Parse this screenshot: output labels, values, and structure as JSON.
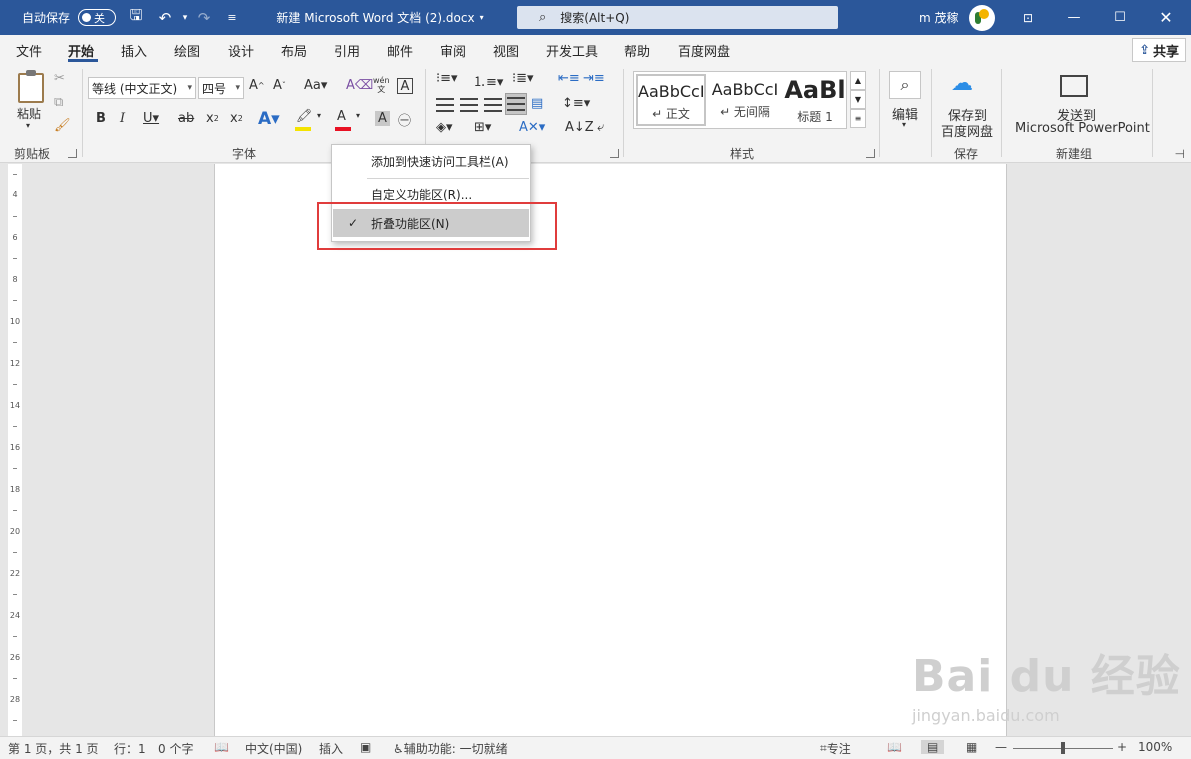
{
  "titlebar": {
    "autosave_label": "自动保存",
    "autosave_state": "关",
    "doc_title": "新建 Microsoft Word 文档 (2).docx",
    "search_placeholder": "搜索(Alt+Q)",
    "user_name": "m 茂稼"
  },
  "tabs": [
    {
      "label": "文件",
      "active": false
    },
    {
      "label": "开始",
      "active": true
    },
    {
      "label": "插入",
      "active": false
    },
    {
      "label": "绘图",
      "active": false
    },
    {
      "label": "设计",
      "active": false
    },
    {
      "label": "布局",
      "active": false
    },
    {
      "label": "引用",
      "active": false
    },
    {
      "label": "邮件",
      "active": false
    },
    {
      "label": "审阅",
      "active": false
    },
    {
      "label": "视图",
      "active": false
    },
    {
      "label": "开发工具",
      "active": false
    },
    {
      "label": "帮助",
      "active": false
    },
    {
      "label": "百度网盘",
      "active": false
    }
  ],
  "share_label": "共享",
  "ribbon": {
    "clipboard": {
      "paste_label": "粘贴",
      "group_label": "剪贴板"
    },
    "font": {
      "font_name": "等线 (中文正文)",
      "font_size": "四号",
      "group_label": "字体",
      "pinyin": "wén"
    },
    "paragraph": {
      "group_label": "段落"
    },
    "styles": {
      "group_label": "样式",
      "items": [
        {
          "sample": "AaBbCcI",
          "name": "↵ 正文"
        },
        {
          "sample": "AaBbCcI",
          "name": "↵ 无间隔"
        },
        {
          "sample": "AaBl",
          "name": "标题 1"
        }
      ]
    },
    "editing": {
      "label": "编辑"
    },
    "baidu": {
      "label_line1": "保存到",
      "label_line2": "百度网盘",
      "group_label": "保存"
    },
    "ppt": {
      "label_line1": "发送到",
      "label_line2": "Microsoft PowerPoint",
      "group_label": "新建组"
    }
  },
  "context_menu": {
    "items": [
      {
        "label": "添加到快速访问工具栏(A)",
        "checked": false
      },
      {
        "label": "自定义功能区(R)...",
        "checked": false
      },
      {
        "label": "折叠功能区(N)",
        "checked": true
      }
    ]
  },
  "ruler_numbers": [
    "4",
    "6",
    "8",
    "10",
    "12",
    "14",
    "16",
    "18",
    "20",
    "22",
    "24",
    "26",
    "28"
  ],
  "statusbar": {
    "page": "第 1 页，共 1 页",
    "line": "行：1",
    "words": "0 个字",
    "language": "中文(中国)",
    "mode": "插入",
    "accessibility": "辅助功能: 一切就绪",
    "focus": "专注",
    "zoom": "100%"
  },
  "watermark": {
    "text": "Bai du 经验",
    "url": "jingyan.baidu.com"
  },
  "colors": {
    "titlebar": "#2b579a",
    "highlight_box": "#e03c3c",
    "font_color_bar": "#e81123",
    "highlight_bar": "#f4e300"
  }
}
